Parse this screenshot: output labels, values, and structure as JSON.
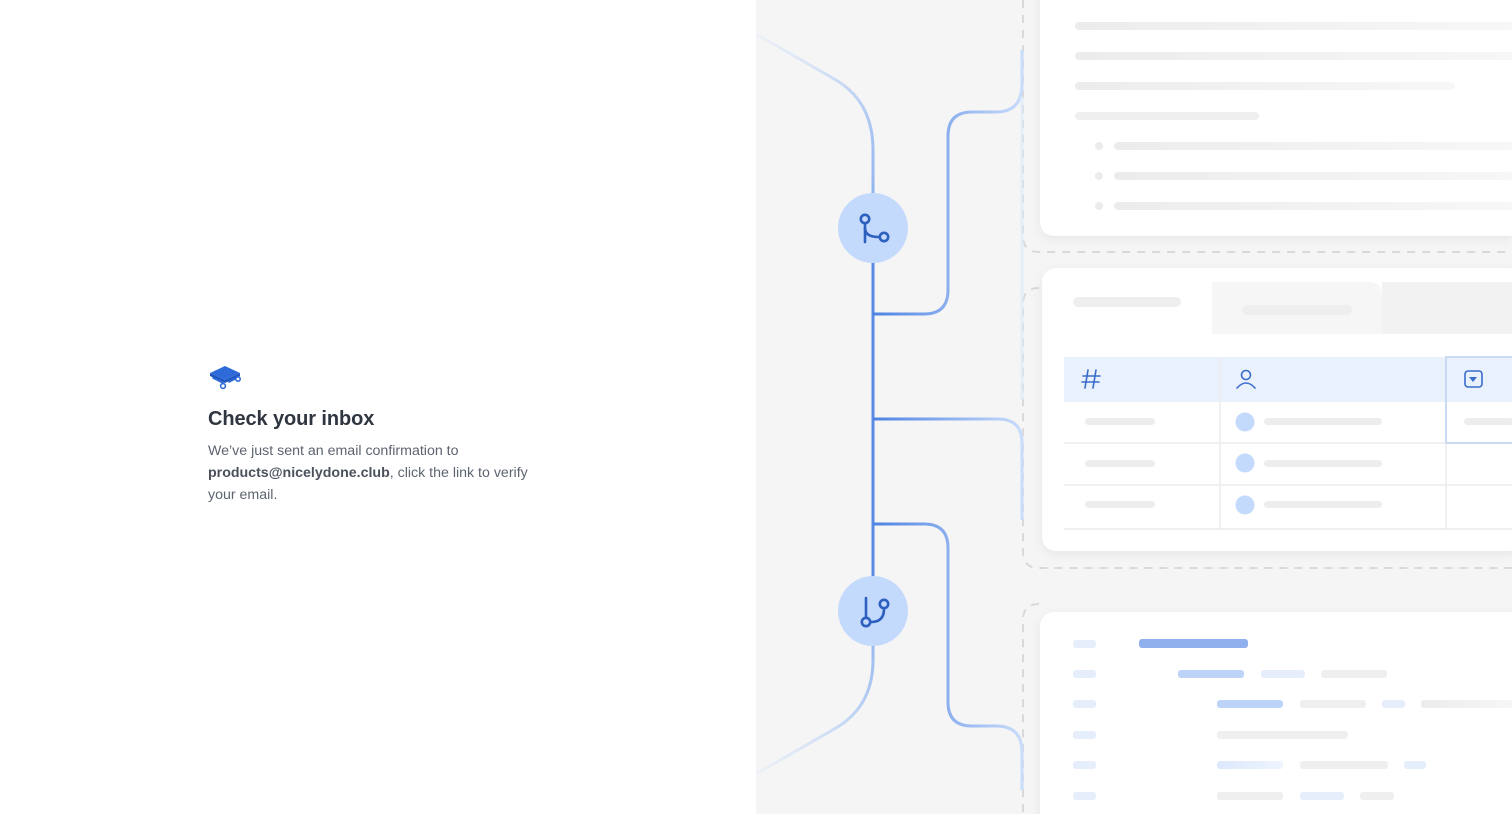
{
  "confirmation": {
    "title": "Check your inbox",
    "message_before": "We’ve just sent an email confirmation to ",
    "email": "products@nicelydone.club",
    "message_after": ", click the link to verify your email."
  },
  "colors": {
    "accent": "#2f6bd8",
    "accent_light": "#c4dafd",
    "illustration_bg": "#f5f5f5"
  },
  "icons": {
    "logo": "book-logo-icon",
    "merge": "git-merge-icon",
    "branch": "git-branch-icon",
    "hash": "hash-icon",
    "user": "user-icon",
    "dropdown": "dropdown-icon"
  }
}
